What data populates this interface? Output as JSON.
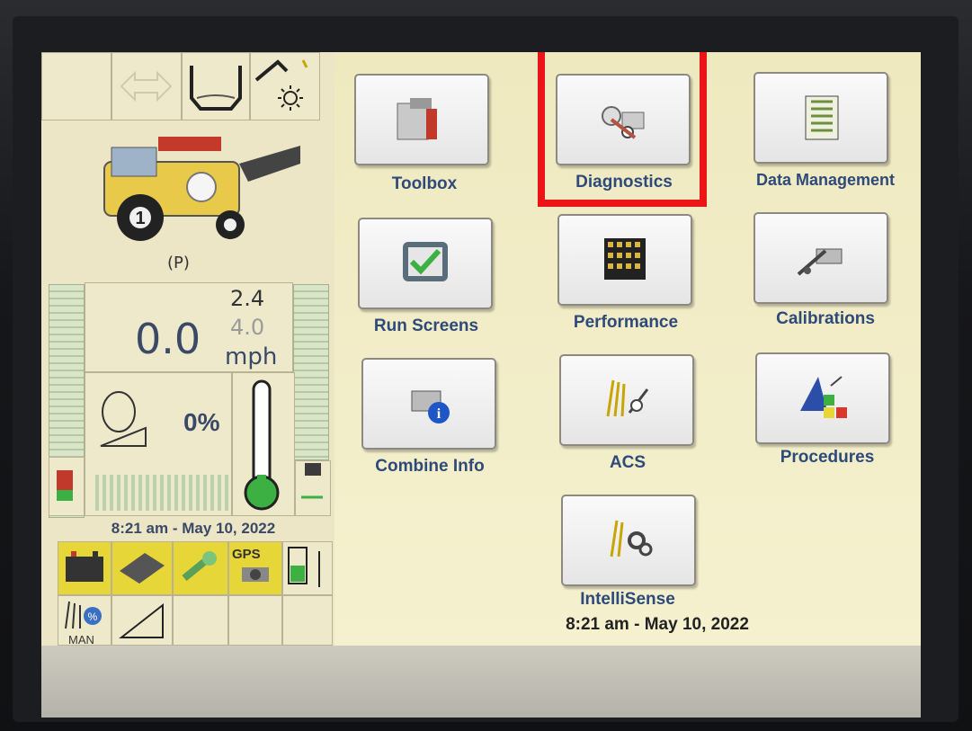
{
  "status": {
    "park_indicator": "(P)",
    "speed_value": "0.0",
    "speed_set_1": "2.4",
    "speed_set_2": "4.0",
    "speed_unit": "mph",
    "engine_load": "0%",
    "datetime_left": "8:21 am - May 10, 2022",
    "gps_label": "GPS",
    "mode_label": "MAN",
    "combine_number": "1"
  },
  "menu": {
    "toolbox": "Toolbox",
    "diagnostics": "Diagnostics",
    "data_management": "Data Management",
    "run_screens": "Run Screens",
    "performance": "Performance",
    "calibrations": "Calibrations",
    "combine_info": "Combine Info",
    "acs": "ACS",
    "procedures": "Procedures",
    "intellisense": "IntelliSense"
  },
  "datetime_bottom": "8:21 am - May 10, 2022",
  "highlight_color": "#ec1416",
  "accent_color": "#2e4a7a",
  "icons": [
    "toolbox-icon",
    "diagnostics-icon",
    "data-management-icon",
    "run-screens-icon",
    "performance-icon",
    "calibrations-icon",
    "combine-info-icon",
    "acs-icon",
    "procedures-icon",
    "intellisense-icon"
  ]
}
